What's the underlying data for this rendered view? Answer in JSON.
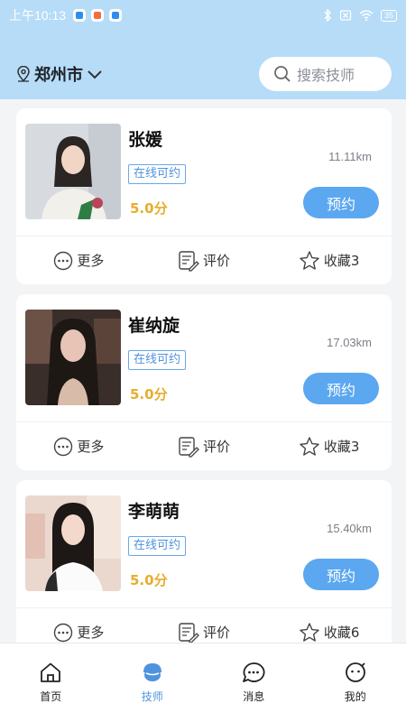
{
  "status_bar": {
    "time": "上午10:13",
    "battery": "35",
    "app_badge_colors": [
      "#2d8cf0",
      "#f36d3a",
      "#2d8cf0"
    ]
  },
  "header": {
    "city": "郑州市",
    "search_placeholder": "搜索技师"
  },
  "technicians": [
    {
      "name": "张媛",
      "status": "在线可约",
      "score": "5.0分",
      "distance": "11.11km",
      "book_label": "预约",
      "more_label": "更多",
      "review_label": "评价",
      "fav_label": "收藏3"
    },
    {
      "name": "崔纳旋",
      "status": "在线可约",
      "score": "5.0分",
      "distance": "17.03km",
      "book_label": "预约",
      "more_label": "更多",
      "review_label": "评价",
      "fav_label": "收藏3"
    },
    {
      "name": "李萌萌",
      "status": "在线可约",
      "score": "5.0分",
      "distance": "15.40km",
      "book_label": "预约",
      "more_label": "更多",
      "review_label": "评价",
      "fav_label": "收藏6"
    }
  ],
  "tabbar": {
    "items": [
      {
        "label": "首页",
        "icon": "home-icon"
      },
      {
        "label": "技师",
        "icon": "technician-icon"
      },
      {
        "label": "消息",
        "icon": "message-icon"
      },
      {
        "label": "我的",
        "icon": "profile-icon"
      }
    ],
    "active": "技师",
    "active_color": "#4f93de"
  },
  "colors": {
    "header_bg": "#b6dcf8",
    "accent": "#5ba7f0",
    "score": "#e7ad2c"
  }
}
